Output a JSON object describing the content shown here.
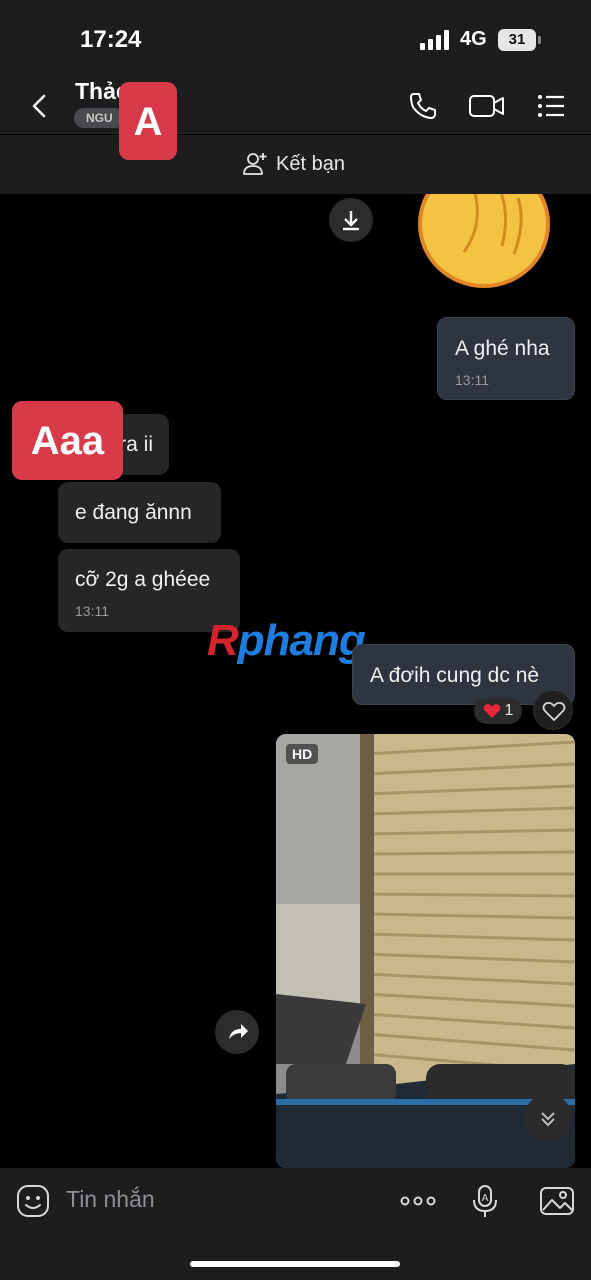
{
  "status_bar": {
    "time": "17:24",
    "network": "4G",
    "battery": "31"
  },
  "header": {
    "contact_name": "Thảo",
    "contact_tag": "NGU",
    "sticker_label": "A",
    "icons": [
      "back-icon",
      "phone-icon",
      "video-call-icon",
      "menu-list-icon"
    ]
  },
  "friend_bar": {
    "label": "Kết bạn"
  },
  "messages": [
    {
      "dir": "out",
      "text": "A ghé nha",
      "time": "13:11"
    },
    {
      "dir": "in",
      "text": "ra ii"
    },
    {
      "dir": "in",
      "text": "e đang ănnn"
    },
    {
      "dir": "in",
      "text": "cỡ 2g a ghéee",
      "time": "13:11"
    },
    {
      "dir": "out",
      "text": "A đơih cung dc nè",
      "reaction_count": "1"
    }
  ],
  "overlay_sticker": "Aaa",
  "watermark": {
    "first": "R",
    "rest": "phang"
  },
  "video": {
    "badge": "HD"
  },
  "composer": {
    "placeholder": "Tin nhắn"
  },
  "colors": {
    "background": "#000000",
    "bar": "#1d1d1f",
    "bubble_out": "#2e3440",
    "bubble_in": "#262628",
    "sticker": "#d93a4a"
  }
}
